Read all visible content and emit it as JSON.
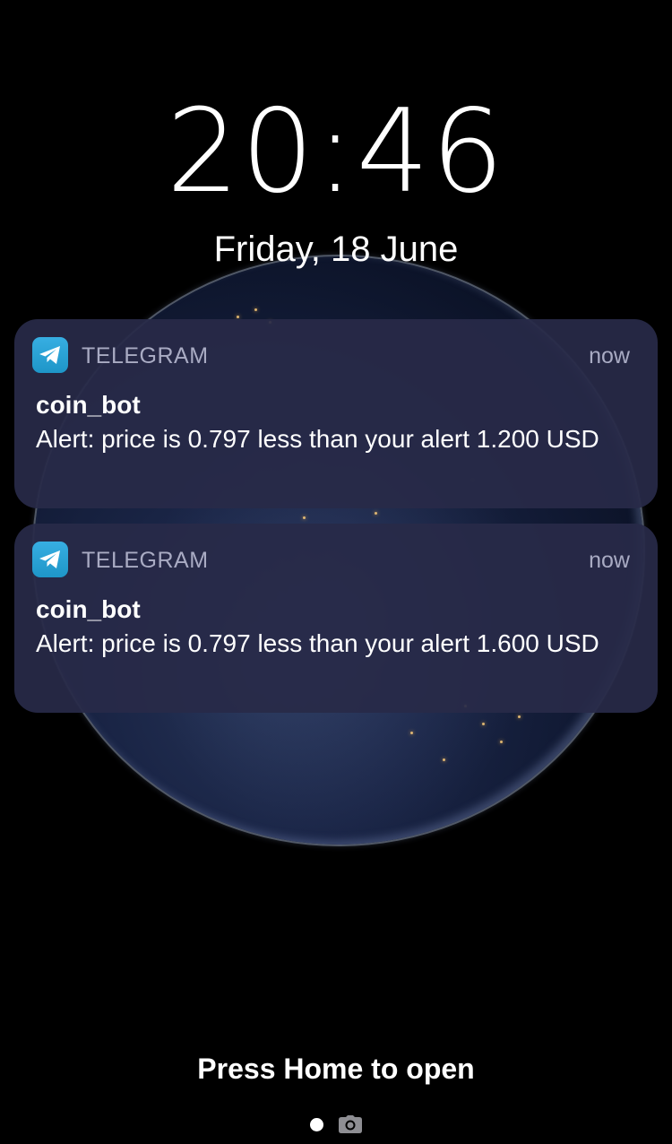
{
  "lockscreen": {
    "time": "20:46",
    "date": "Friday, 18 June",
    "wallpaper": "earth-at-night"
  },
  "notifications": [
    {
      "app": "TELEGRAM",
      "icon": "telegram-icon",
      "time": "now",
      "sender": "coin_bot",
      "message": "Alert: price is 0.797 less than your alert 1.200 USD"
    },
    {
      "app": "TELEGRAM",
      "icon": "telegram-icon",
      "time": "now",
      "sender": "coin_bot",
      "message": "Alert: price is 0.797 less than your alert 1.600 USD"
    }
  ],
  "footer": {
    "press_home": "Press Home to open",
    "camera_icon": "camera-icon"
  },
  "colors": {
    "notification_bg": "#282a48",
    "telegram_blue": "#37aee2",
    "secondary_text": "#a9abc3"
  }
}
